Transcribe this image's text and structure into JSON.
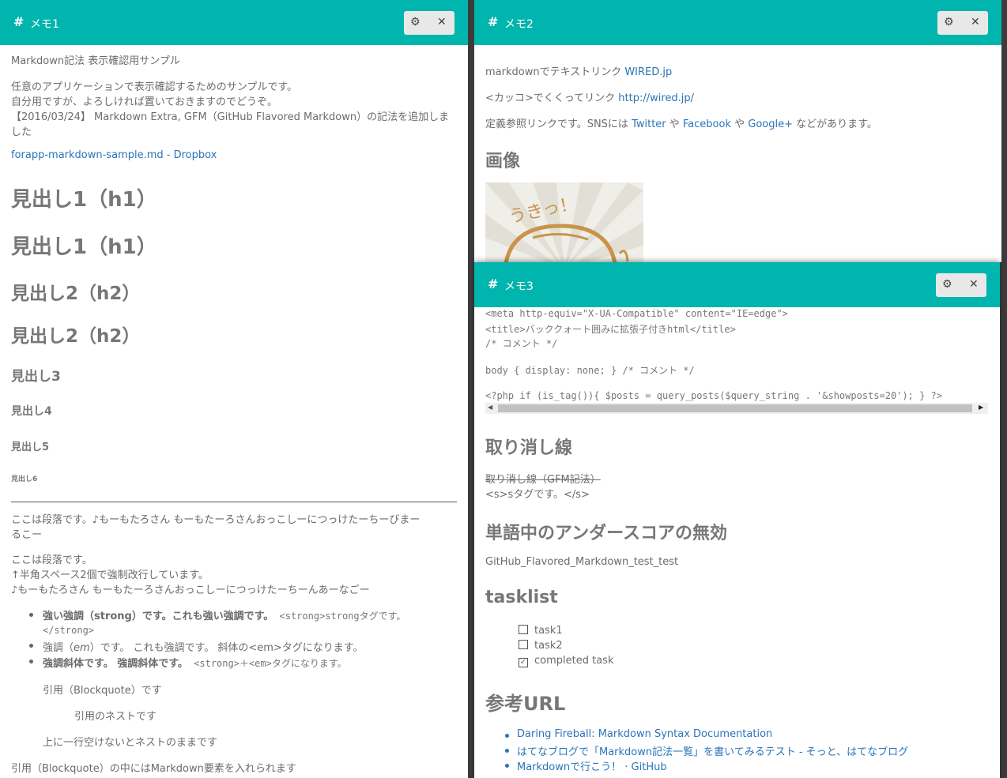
{
  "memo1": {
    "title_icon": "#",
    "title": "メモ1",
    "gear_icon": "⚙",
    "close_icon": "✕",
    "heading_text": "Markdown記法 表示確認用サンプル",
    "intro_lines": [
      "任意のアプリケーションで表示確認するためのサンプルです。",
      "自分用ですが、よろしければ置いておきますのでどうぞ。",
      "【2016/03/24】 Markdown Extra, GFM（GitHub Flavored Markdown）の記法を追加しま",
      "した"
    ],
    "dropbox_link": "forapp-markdown-sample.md - Dropbox",
    "h1_a": "見出し1（h1）",
    "h1_b": "見出し1（h1）",
    "h2_a": "見出し2（h2）",
    "h2_b": "見出し2（h2）",
    "h3": "見出し3",
    "h4": "見出し4",
    "h5": "見出し5",
    "h6": "見出し6",
    "para1_lines": [
      "ここは段落です。♪もーもたろさん もーもたーろさんおっこしーにつっけたーちーびまー",
      "るこー"
    ],
    "para2_lines": [
      "ここは段落です。",
      "↑半角スペース2個で強制改行しています。",
      "♪もーもたろさん もーもたーろさんおっこしーにつっけたーちーんあーなごー"
    ],
    "list": {
      "i1_strong_a": "強い強調（strong）です。",
      "i1_strong_b": "これも強い強調です。",
      "i1_code": " <strong>strongタグです。",
      "i1_code2": "</strong>",
      "i2_a": "強調（",
      "i2_em": "em",
      "i2_b": "）です。 これも強調です。 斜体の<em>タグになります。",
      "i3_strong": "強調斜体です。 強調斜体です。",
      "i3_rest": " <strong>＋<em>タグになります。"
    },
    "quote1": "引用（Blockquote）です",
    "quote_nest": "引用のネストです",
    "quote2": "上に一行空けないとネストのままです",
    "quote_note": "引用（Blockquote）の中にはMarkdown要素を入れられます"
  },
  "memo2": {
    "title_icon": "#",
    "title": "メモ2",
    "gear_icon": "⚙",
    "close_icon": "✕",
    "link_line1_text": "markdownでテキストリンク ",
    "link_line1_link": "WIRED.jp",
    "link_line2_text": "<カッコ>でくくってリンク ",
    "link_line2_link": "http://wired.jp/",
    "link_line3_a": "定義参照リンクです。SNSには ",
    "twitter": "Twitter",
    "ya1": " や ",
    "facebook": "Facebook",
    "ya2": " や ",
    "googleplus": "Google+",
    "link_line3_b": " などがあります。",
    "image_heading": "画像",
    "image_text": "うきっ！"
  },
  "memo3": {
    "title_icon": "#",
    "title": "メモ3",
    "gear_icon": "⚙",
    "close_icon": "✕",
    "code_lines": [
      "<meta http-equiv=\"X-UA-Compatible\" content=\"IE=edge\">",
      "<title>バッククォート囲みに拡張子付きhtml</title>",
      "/* コメント */",
      "",
      "body { display: none; } /* コメント */",
      "",
      "<?php if (is_tag()){ $posts = query_posts($query_string . '&showposts=20'); } ?>"
    ],
    "scroll_left": "◀",
    "scroll_right": "▶",
    "strike_heading": "取り消し線",
    "strike_text": "取り消し線（GFM記法）",
    "s_tag_text": "<s>sタグです。</s>",
    "underscore_heading": "単語中のアンダースコアの無効",
    "underscore_text": "GitHub_Flavored_Markdown_test_test",
    "tasklist_heading": "tasklist",
    "tasks": [
      {
        "label": "task1",
        "checked": false
      },
      {
        "label": "task2",
        "checked": false
      },
      {
        "label": "completed task",
        "checked": true
      }
    ],
    "check_mark": "✓",
    "ref_heading": "参考URL",
    "refs": [
      "Daring Fireball: Markdown Syntax Documentation",
      "はてなブログで「Markdown記法一覧」を書いてみるテスト - そっと、はてなブログ",
      "Markdownで行こう！ · GitHub"
    ]
  },
  "colors": {
    "titlebar": "#00b5ad",
    "link": "#2a74b9",
    "text": "#6b6b6b"
  }
}
